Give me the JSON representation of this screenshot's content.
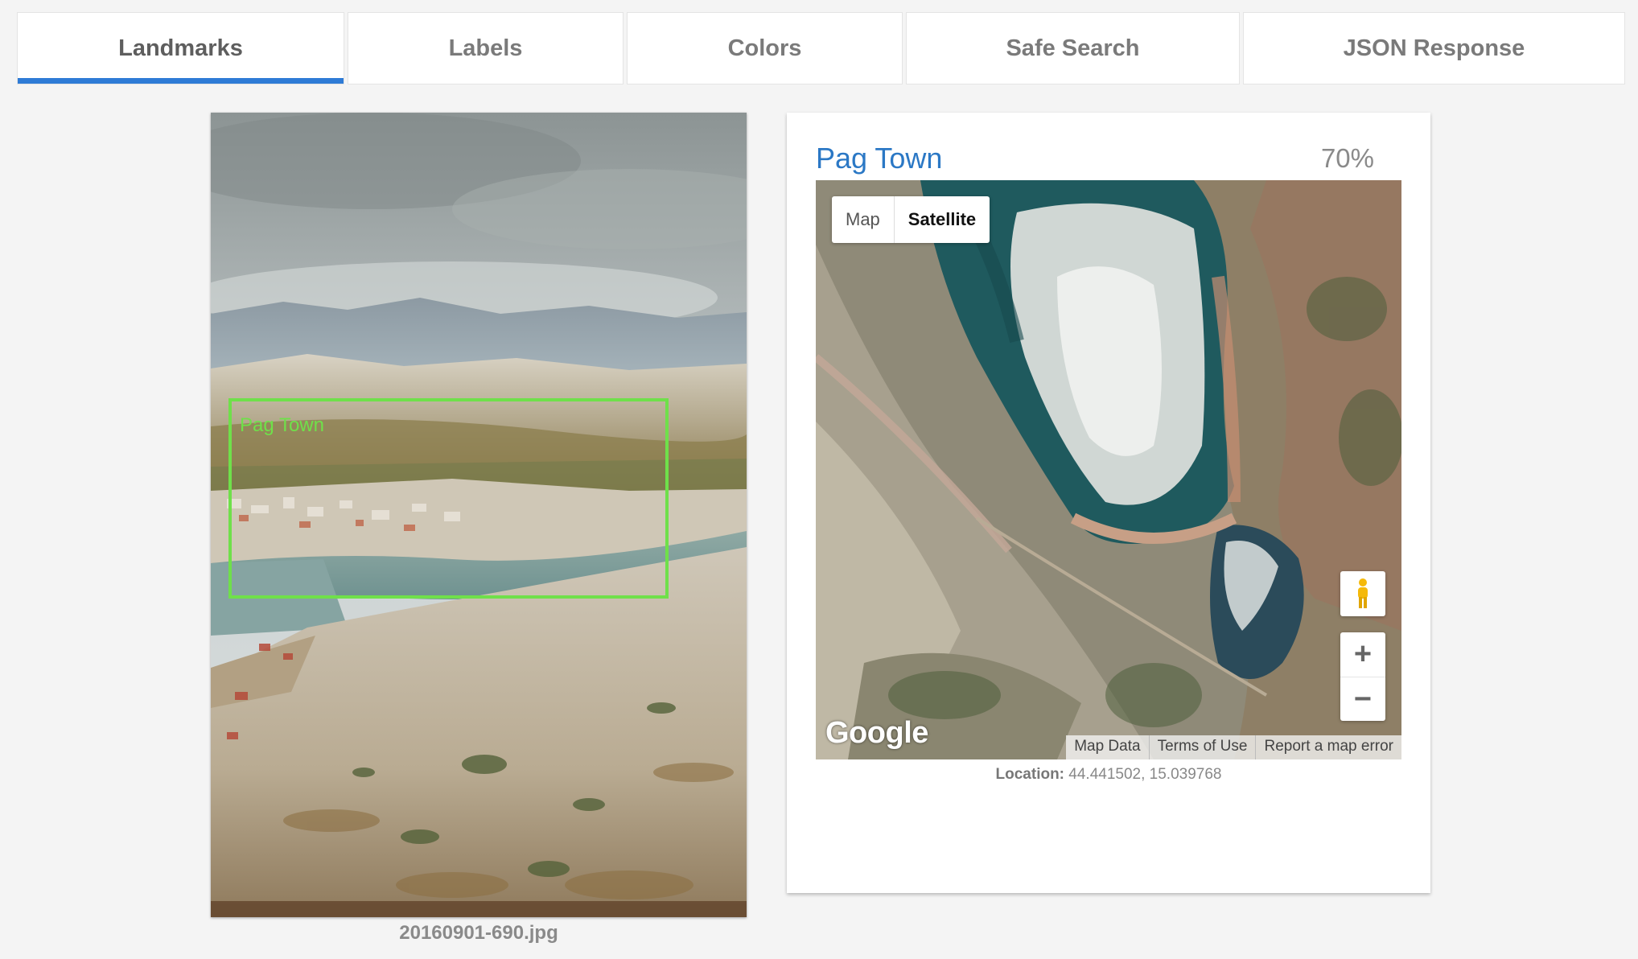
{
  "tabs": [
    {
      "label": "Landmarks",
      "active": true
    },
    {
      "label": "Labels",
      "active": false
    },
    {
      "label": "Colors",
      "active": false
    },
    {
      "label": "Safe Search",
      "active": false
    },
    {
      "label": "JSON Response",
      "active": false
    }
  ],
  "photo": {
    "filename": "20160901-690.jpg",
    "box_label": "Pag Town"
  },
  "result": {
    "name": "Pag Town",
    "score": "70%",
    "map": {
      "type_buttons": [
        "Map",
        "Satellite"
      ],
      "selected_type": "Satellite",
      "logo_text": "Google",
      "footer_links": [
        "Map Data",
        "Terms of Use",
        "Report a map error"
      ],
      "zoom_in": "+",
      "zoom_out": "−"
    },
    "location_label": "Location:",
    "location_value": "44.441502, 15.039768"
  },
  "colors": {
    "accent": "#2e7bd6",
    "title": "#2b78c5",
    "bounding_box": "#6fe04a"
  }
}
